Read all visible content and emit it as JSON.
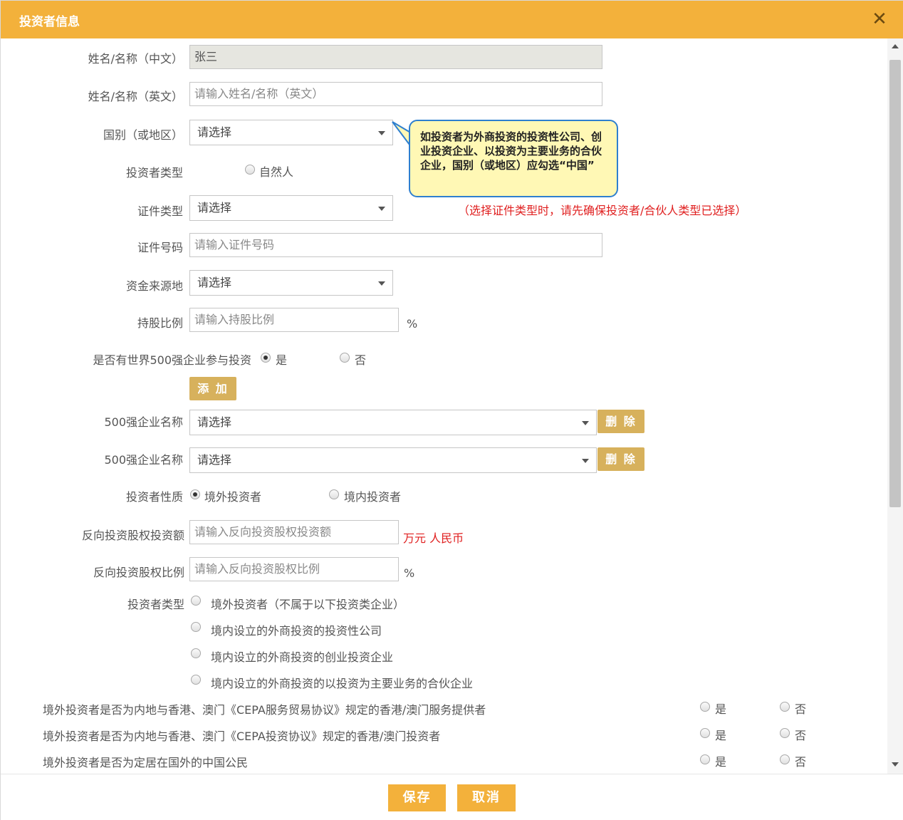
{
  "dialog": {
    "title": "投资者信息",
    "close_icon": "close-icon"
  },
  "form": {
    "name_cn": {
      "label": "姓名/名称（中文）",
      "value": "张三"
    },
    "name_en": {
      "label": "姓名/名称（英文）",
      "placeholder": "请输入姓名/名称（英文）"
    },
    "country": {
      "label": "国别（或地区）",
      "selected": "请选择"
    },
    "tooltip": "如投资者为外商投资的投资性公司、创业投资企业、以投资为主要业务的合伙企业，国别（或地区）应勾选“中国”",
    "investor_type_top": {
      "label": "投资者类型",
      "option": "自然人"
    },
    "id_type": {
      "label": "证件类型",
      "selected": "请选择",
      "hint": "（选择证件类型时，请先确保投资者/合伙人类型已选择）"
    },
    "id_number": {
      "label": "证件号码",
      "placeholder": "请输入证件号码"
    },
    "fund_source": {
      "label": "资金来源地",
      "selected": "请选择"
    },
    "share_ratio": {
      "label": "持股比例",
      "placeholder": "请输入持股比例",
      "unit": "%"
    },
    "fortune500": {
      "label": "是否有世界500强企业参与投资",
      "yes": "是",
      "no": "否",
      "selected": "yes"
    },
    "add_button": "添 加",
    "fortune500_rows": [
      {
        "label": "500强企业名称",
        "selected": "请选择",
        "delete": "删 除"
      },
      {
        "label": "500强企业名称",
        "selected": "请选择",
        "delete": "删 除"
      }
    ],
    "nature": {
      "label": "投资者性质",
      "foreign": "境外投资者",
      "domestic": "境内投资者",
      "selected": "foreign"
    },
    "reverse_amount": {
      "label": "反向投资股权投资额",
      "placeholder": "请输入反向投资股权投资额",
      "unit": "万元 人民币"
    },
    "reverse_ratio": {
      "label": "反向投资股权比例",
      "placeholder": "请输入反向投资股权比例",
      "unit": "%"
    },
    "investor_type": {
      "label": "投资者类型",
      "options": [
        "境外投资者（不属于以下投资类企业）",
        "境内设立的外商投资的投资性公司",
        "境内设立的外商投资的创业投资企业",
        "境内设立的外商投资的以投资为主要业务的合伙企业"
      ]
    },
    "questions": [
      {
        "text": "境外投资者是否为内地与香港、澳门《CEPA服务贸易协议》规定的香港/澳门服务提供者",
        "yes": "是",
        "no": "否"
      },
      {
        "text": "境外投资者是否为内地与香港、澳门《CEPA投资协议》规定的香港/澳门投资者",
        "yes": "是",
        "no": "否"
      },
      {
        "text": "境外投资者是否为定居在国外的中国公民",
        "yes": "是",
        "no": "否"
      }
    ]
  },
  "footer": {
    "save": "保存",
    "cancel": "取消"
  },
  "colors": {
    "header": "#f3b13b",
    "gold_button": "#d7b15c",
    "hint_red": "#e02020",
    "tooltip_bg": "#fff8b5",
    "tooltip_border": "#2e7fcf"
  }
}
